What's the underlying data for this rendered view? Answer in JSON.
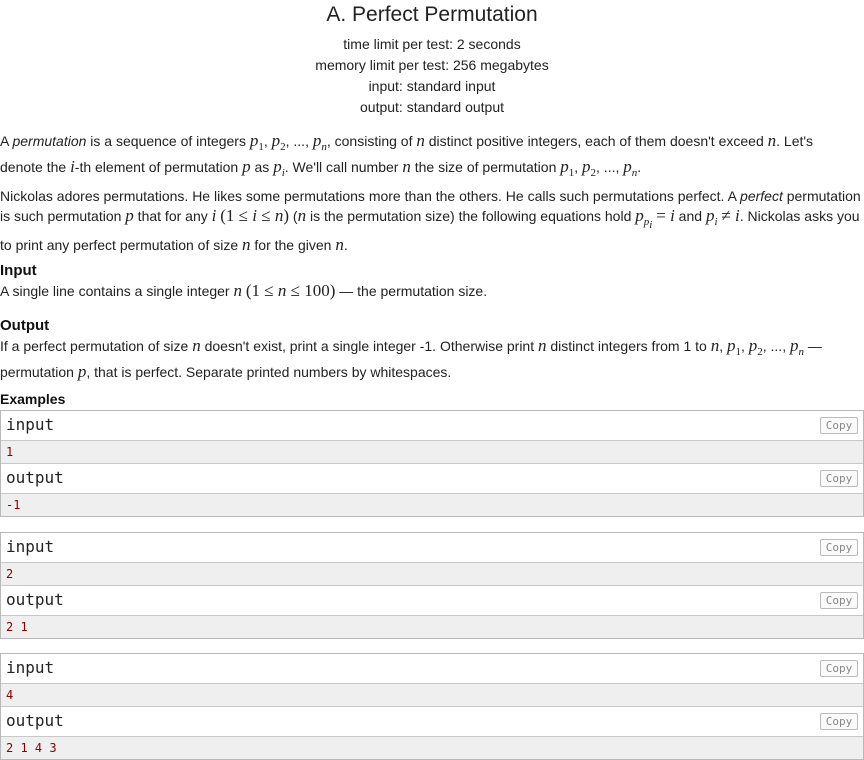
{
  "problem": {
    "title": "A. Perfect Permutation",
    "limits": [
      "time limit per test: 2 seconds",
      "memory limit per test: 256 megabytes",
      "input: standard input",
      "output: standard output"
    ]
  },
  "statement": {
    "p1": {
      "a": "A ",
      "permutation": "permutation",
      "b": " is a sequence of integers ",
      "c": ", consisting of ",
      "d": " distinct positive integers, each of them doesn't exceed ",
      "e": ". Let's",
      "f": "denote the ",
      "g": "-th element of permutation ",
      "h": " as ",
      "i": ". We'll call number ",
      "j": " the size of permutation "
    },
    "p2": {
      "a": "Nickolas adores permutations. He likes some permutations more than the others. He calls such permutations perfect. A ",
      "perfect": "perfect",
      "b": " permutation",
      "c": "is such permutation ",
      "d": " that for any ",
      "e": " is the permutation size) the following equations hold ",
      "f": " and ",
      "g": ". Nickolas asks you",
      "h": "to print any perfect permutation of size ",
      "i": " for the given "
    }
  },
  "input_section": {
    "heading": "Input",
    "a": "A single line contains a single integer ",
    "b": " — the permutation size."
  },
  "output_section": {
    "heading": "Output",
    "a": "If a perfect permutation of size ",
    "b": " doesn't exist, print a single integer -1. Otherwise print ",
    "c": " distinct integers from 1 to ",
    "d": " —",
    "e": "permutation ",
    "f": ", that is perfect. Separate printed numbers by whitespaces."
  },
  "examples": {
    "heading": "Examples",
    "input_label": "input",
    "output_label": "output",
    "copy_label": "Copy",
    "tests": [
      {
        "input": "1",
        "output": "-1"
      },
      {
        "input": "2",
        "output": "2 1"
      },
      {
        "input": "4",
        "output": "2 1 4 3"
      }
    ]
  }
}
